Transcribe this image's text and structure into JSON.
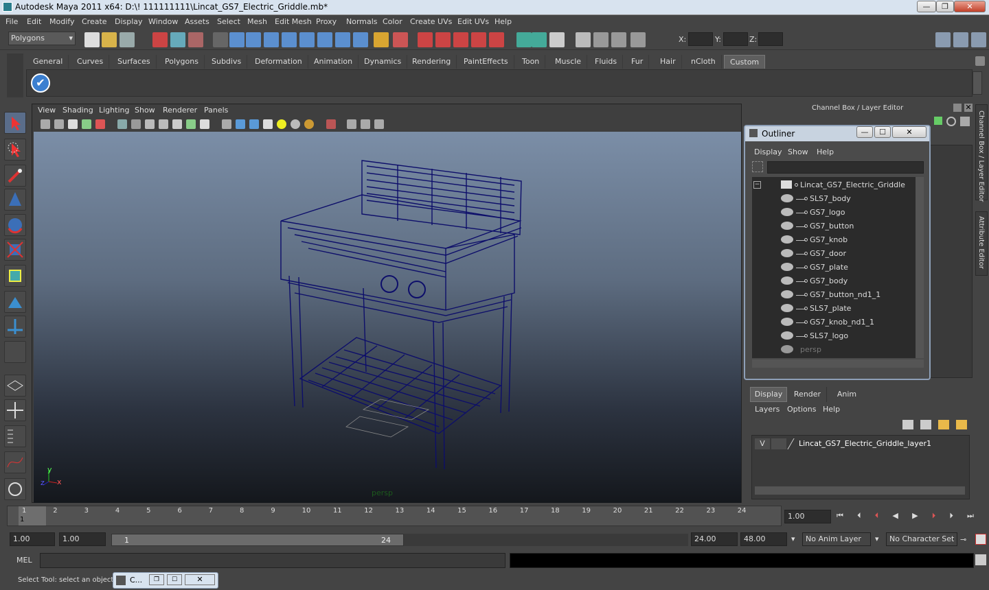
{
  "window": {
    "title": "Autodesk Maya 2011 x64: D:\\! 111111111\\Lincat_GS7_Electric_Griddle.mb*",
    "min": "—",
    "max": "❐",
    "close": "✕"
  },
  "menu": [
    "File",
    "Edit",
    "Modify",
    "Create",
    "Display",
    "Window",
    "Assets",
    "Select",
    "Mesh",
    "Edit Mesh",
    "Proxy",
    "Normals",
    "Color",
    "Create UVs",
    "Edit UVs",
    "Help"
  ],
  "status": {
    "mode": "Polygons",
    "x_label": "X:",
    "y_label": "Y:",
    "z_label": "Z:"
  },
  "shelf_tabs": [
    "General",
    "Curves",
    "Surfaces",
    "Polygons",
    "Subdivs",
    "Deformation",
    "Animation",
    "Dynamics",
    "Rendering",
    "PaintEffects",
    "Toon",
    "Muscle",
    "Fluids",
    "Fur",
    "Hair",
    "nCloth",
    "Custom"
  ],
  "shelf_active": "Custom",
  "viewport": {
    "menu": [
      "View",
      "Shading",
      "Lighting",
      "Show",
      "Renderer",
      "Panels"
    ],
    "camera_label": "persp",
    "axis_y": "y",
    "axis_x": "x",
    "axis_z": "z"
  },
  "right_panel": {
    "title": "Channel Box / Layer Editor",
    "side_tab_1": "Channel Box / Layer Editor",
    "side_tab_2": "Attribute Editor"
  },
  "outliner": {
    "title": "Outliner",
    "menu": [
      "Display",
      "Show",
      "Help"
    ],
    "root": "Lincat_GS7_Electric_Griddle",
    "items": [
      "SLS7_body",
      "GS7_logo",
      "GS7_button",
      "GS7_knob",
      "GS7_door",
      "GS7_plate",
      "GS7_body",
      "GS7_button_nd1_1",
      "SLS7_plate",
      "GS7_knob_nd1_1",
      "SLS7_logo"
    ],
    "camera": "persp"
  },
  "layer_editor": {
    "tabs": [
      "Display",
      "Render",
      "Anim"
    ],
    "menu": [
      "Layers",
      "Options",
      "Help"
    ],
    "layer_v": "V",
    "layer_name": "Lincat_GS7_Electric_Griddle_layer1"
  },
  "timeline": {
    "ticks": [
      "1",
      "2",
      "3",
      "4",
      "5",
      "6",
      "7",
      "8",
      "9",
      "10",
      "11",
      "12",
      "13",
      "14",
      "15",
      "16",
      "17",
      "18",
      "19",
      "20",
      "21",
      "22",
      "23",
      "24"
    ],
    "current": "1",
    "current_time": "1.00"
  },
  "range": {
    "start": "1.00",
    "anim_start": "1.00",
    "slider_start": "1",
    "slider_end": "24",
    "end": "24.00",
    "anim_end": "48.00",
    "anim_layer": "No Anim Layer",
    "char_set": "No Character Set"
  },
  "mel": {
    "label": "MEL"
  },
  "help": {
    "text": "Select Tool: select an object",
    "task": "C..."
  }
}
